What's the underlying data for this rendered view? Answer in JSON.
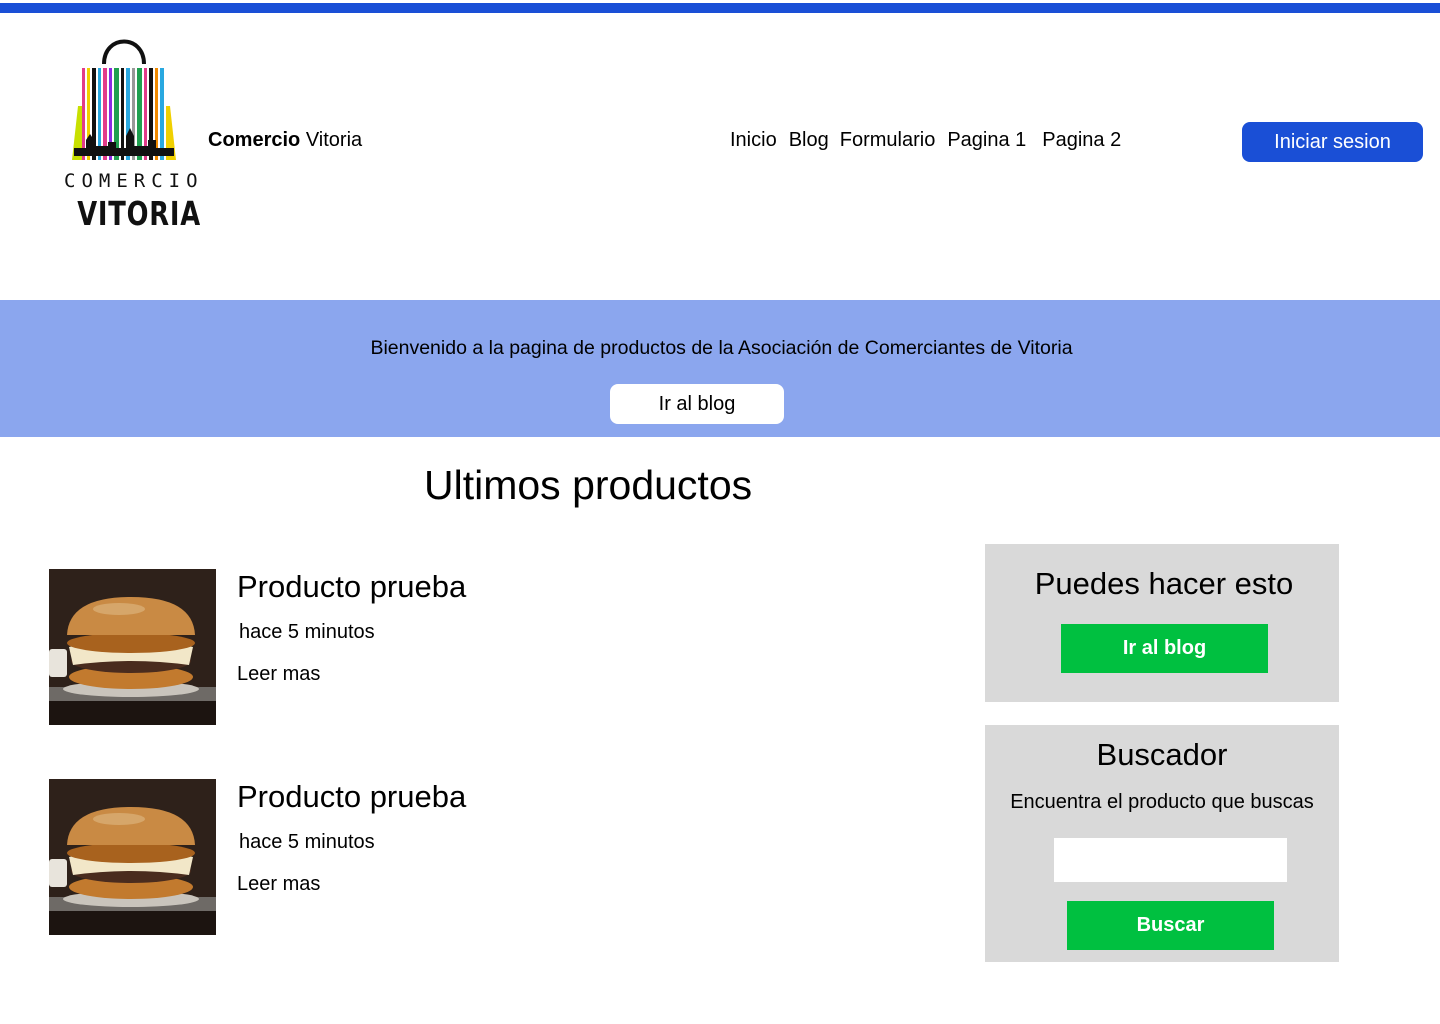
{
  "header": {
    "logo": {
      "line1": "COMERCIO",
      "line2": "VITORIA"
    },
    "brand_bold": "Comercio",
    "brand_rest": "Vitoria",
    "nav": [
      "Inicio",
      "Blog",
      "Formulario",
      "Pagina 1",
      "Pagina 2"
    ],
    "login_label": "Iniciar sesion",
    "accent_color": "#1a4fd6"
  },
  "hero": {
    "message": "Bienvenido a la pagina de productos de la Asociación de Comerciantes de Vitoria",
    "button_label": "Ir al blog",
    "background_color": "#8ba6ee"
  },
  "main": {
    "section_title": "Ultimos productos",
    "products": [
      {
        "title": "Producto prueba",
        "time": "hace 5 minutos",
        "link": "Leer mas"
      },
      {
        "title": "Producto prueba",
        "time": "hace 5 minutos",
        "link": "Leer mas"
      }
    ]
  },
  "sidebar": {
    "actions": {
      "title": "Puedes hacer esto",
      "button_label": "Ir al blog"
    },
    "search": {
      "title": "Buscador",
      "subtitle": "Encuentra el producto que buscas",
      "input_value": "",
      "button_label": "Buscar"
    },
    "button_color": "#00c040"
  }
}
